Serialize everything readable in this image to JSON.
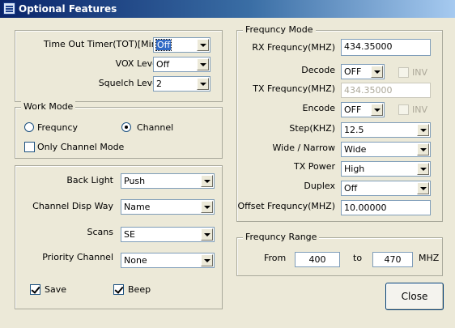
{
  "window": {
    "title": "Optional Features"
  },
  "timers": {
    "tot_label": "Time Out Timer(TOT)[Min]",
    "tot_value": "Off",
    "vox_label": "VOX Level",
    "vox_value": "Off",
    "squelch_label": "Squelch Level",
    "squelch_value": "2"
  },
  "work_mode": {
    "legend": "Work Mode",
    "frequncy_label": "Frequncy",
    "channel_label": "Channel",
    "selected": "Channel",
    "only_channel_label": "Only Channel Mode",
    "only_channel_checked": false
  },
  "display": {
    "back_light_label": "Back Light",
    "back_light_value": "Push",
    "channel_disp_label": "Channel Disp Way",
    "channel_disp_value": "Name",
    "scans_label": "Scans",
    "scans_value": "SE",
    "priority_label": "Priority Channel",
    "priority_value": "None",
    "save_label": "Save",
    "save_checked": true,
    "beep_label": "Beep",
    "beep_checked": true
  },
  "freq_mode": {
    "legend": "Frequncy Mode",
    "rx_label": "RX Frequncy(MHZ)",
    "rx_value": "434.35000",
    "decode_label": "Decode",
    "decode_value": "OFF",
    "decode_inv_label": "INV",
    "tx_label": "TX Frequncy(MHZ)",
    "tx_value": "434.35000",
    "encode_label": "Encode",
    "encode_value": "OFF",
    "encode_inv_label": "INV",
    "step_label": "Step(KHZ)",
    "step_value": "12.5",
    "wide_label": "Wide / Narrow",
    "wide_value": "Wide",
    "txpower_label": "TX Power",
    "txpower_value": "High",
    "duplex_label": "Duplex",
    "duplex_value": "Off",
    "offset_label": "Offset Frequncy(MHZ)",
    "offset_value": "10.00000"
  },
  "freq_range": {
    "legend": "Frequncy Range",
    "from_label": "From",
    "from_value": "400",
    "to_label": "to",
    "to_value": "470",
    "unit_label": "MHZ"
  },
  "actions": {
    "close_label": "Close"
  }
}
